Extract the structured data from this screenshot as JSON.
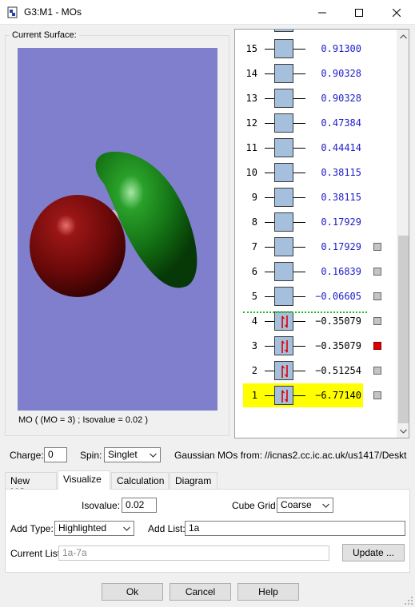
{
  "window": {
    "title": "G3:M1 - MOs"
  },
  "surface": {
    "group_label": "Current Surface:",
    "caption": "MO ( (MO = 3) ; Isovalue = 0.02 )"
  },
  "mo_list": {
    "rows": [
      {
        "num": "15",
        "energy": "0.91300",
        "occupied": false,
        "checkbox": "none",
        "highlighted": false
      },
      {
        "num": "14",
        "energy": "0.90328",
        "occupied": false,
        "checkbox": "none",
        "highlighted": false
      },
      {
        "num": "13",
        "energy": "0.90328",
        "occupied": false,
        "checkbox": "none",
        "highlighted": false
      },
      {
        "num": "12",
        "energy": "0.47384",
        "occupied": false,
        "checkbox": "none",
        "highlighted": false
      },
      {
        "num": "11",
        "energy": "0.44414",
        "occupied": false,
        "checkbox": "none",
        "highlighted": false
      },
      {
        "num": "10",
        "energy": "0.38115",
        "occupied": false,
        "checkbox": "none",
        "highlighted": false
      },
      {
        "num": "9",
        "energy": "0.38115",
        "occupied": false,
        "checkbox": "none",
        "highlighted": false
      },
      {
        "num": "8",
        "energy": "0.17929",
        "occupied": false,
        "checkbox": "none",
        "highlighted": false
      },
      {
        "num": "7",
        "energy": "0.17929",
        "occupied": false,
        "checkbox": "gray",
        "highlighted": false
      },
      {
        "num": "6",
        "energy": "0.16839",
        "occupied": false,
        "checkbox": "gray",
        "highlighted": false
      },
      {
        "num": "5",
        "energy": "−0.06605",
        "occupied": false,
        "checkbox": "gray",
        "highlighted": false
      },
      {
        "num": "4",
        "energy": "−0.35079",
        "occupied": true,
        "checkbox": "gray",
        "highlighted": false
      },
      {
        "num": "3",
        "energy": "−0.35079",
        "occupied": true,
        "checkbox": "red",
        "highlighted": false
      },
      {
        "num": "2",
        "energy": "−0.51254",
        "occupied": true,
        "checkbox": "gray",
        "highlighted": false
      },
      {
        "num": "1",
        "energy": "−6.77140",
        "occupied": true,
        "checkbox": "gray",
        "highlighted": true
      }
    ],
    "colors": {
      "virtual_energy": "#1d1dc8",
      "homo_lumo_separator": "#1bbd1b",
      "highlight": "#ffff00",
      "selected_checkbox": "#e00000",
      "orbital_box": "#a5c0dc"
    }
  },
  "settings": {
    "charge_label": "Charge:",
    "charge_value": "0",
    "spin_label": "Spin:",
    "spin_value": "Singlet",
    "source_label": "Gaussian MOs from:",
    "source_path": "//icnas2.cc.ic.ac.uk/us1417/Deskt"
  },
  "tabs": [
    {
      "label": "New MOs",
      "active": false
    },
    {
      "label": "Visualize",
      "active": true
    },
    {
      "label": "Calculation",
      "active": false
    },
    {
      "label": "Diagram",
      "active": false
    }
  ],
  "visualize": {
    "isovalue_label": "Isovalue:",
    "isovalue_value": "0.02",
    "cube_grid_label": "Cube Grid:",
    "cube_grid_value": "Coarse",
    "add_type_label": "Add Type:",
    "add_type_value": "Highlighted",
    "add_list_label": "Add List:",
    "add_list_value": "1a",
    "current_list_label": "Current List:",
    "current_list_value": "1a-7a",
    "update_button": "Update ..."
  },
  "footer": {
    "ok": "Ok",
    "cancel": "Cancel",
    "help": "Help"
  },
  "view3d": {
    "background": "#7f7fce",
    "lobe_positive": "#1a7a1a",
    "lobe_negative": "#7a0d0d"
  }
}
